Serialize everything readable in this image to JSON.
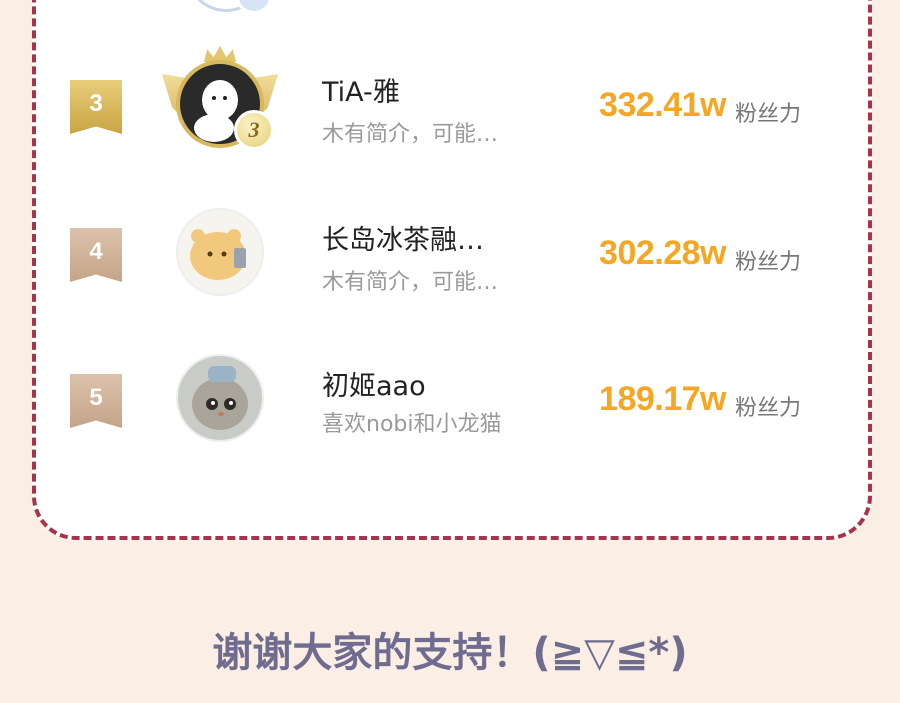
{
  "ranking": {
    "rows": [
      {
        "rank": "3",
        "medal": "3",
        "name": "TiA-雅",
        "desc": "木有简介，可能…",
        "fans": "332.41w",
        "fans_label": "粉丝力",
        "avatar": "white-blob-avatar-with-gold-frame"
      },
      {
        "rank": "4",
        "name": "长岛冰茶融…",
        "desc": "木有简介，可能…",
        "fans": "302.28w",
        "fans_label": "粉丝力",
        "avatar": "bear-with-phone-avatar"
      },
      {
        "rank": "5",
        "name": "初姬aao",
        "desc": "喜欢nobi和小龙猫",
        "fans": "189.17w",
        "fans_label": "粉丝力",
        "avatar": "plush-doll-avatar"
      }
    ]
  },
  "footer": {
    "text": "谢谢大家的支持！(≧▽≦*)"
  },
  "colors": {
    "background": "#fbeee4",
    "card_border": "#a8334b",
    "fans_number": "#f5a623",
    "footer_text": "#6f6c90"
  }
}
